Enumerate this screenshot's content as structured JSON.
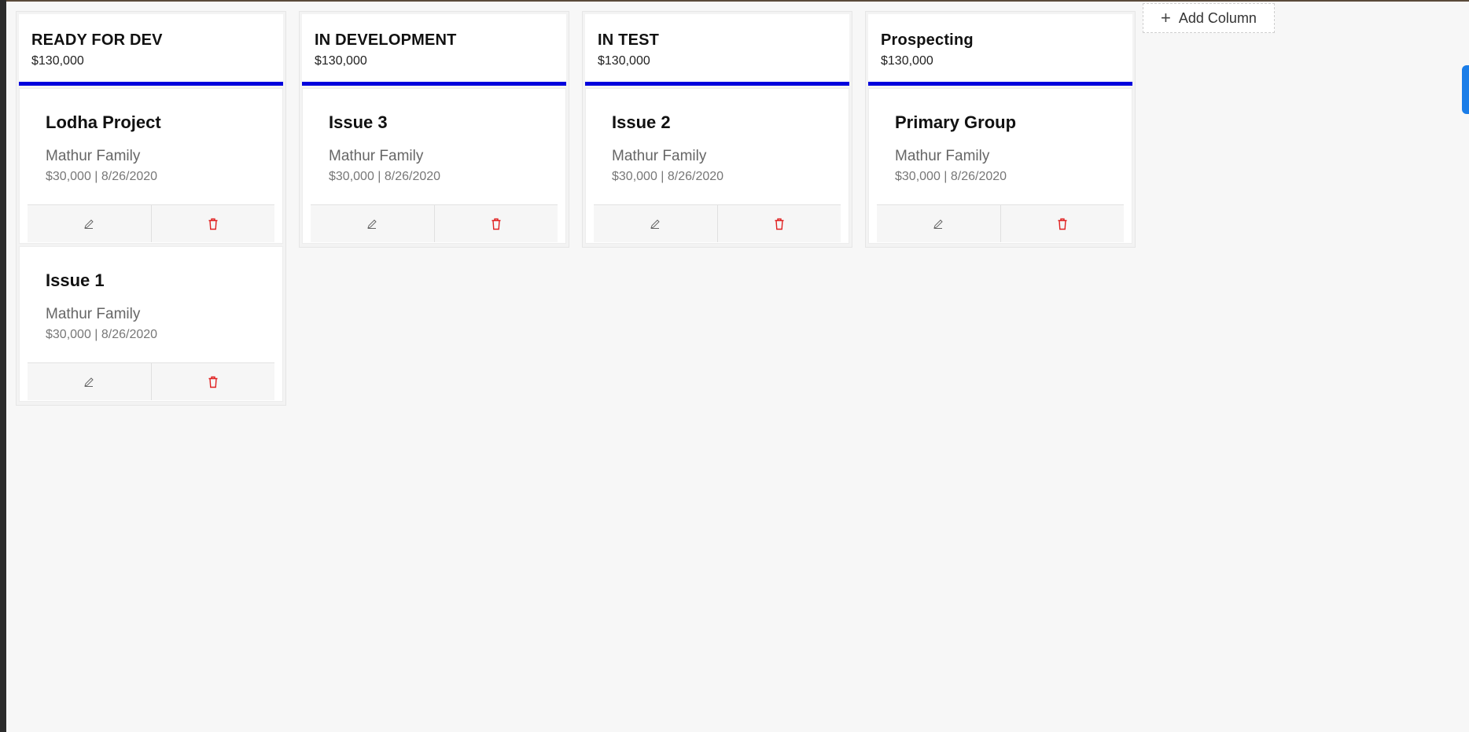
{
  "columns": [
    {
      "title": "READY FOR DEV",
      "total": "$130,000",
      "cards": [
        {
          "title": "Lodha Project",
          "client": "Mathur Family",
          "meta": "$30,000 | 8/26/2020"
        },
        {
          "title": "Issue 1",
          "client": "Mathur Family",
          "meta": "$30,000 | 8/26/2020"
        }
      ]
    },
    {
      "title": "IN DEVELOPMENT",
      "total": "$130,000",
      "cards": [
        {
          "title": "Issue 3",
          "client": "Mathur Family",
          "meta": "$30,000 | 8/26/2020"
        }
      ]
    },
    {
      "title": "IN TEST",
      "total": "$130,000",
      "cards": [
        {
          "title": "Issue 2",
          "client": "Mathur Family",
          "meta": "$30,000 | 8/26/2020"
        }
      ]
    },
    {
      "title": "Prospecting",
      "total": "$130,000",
      "cards": [
        {
          "title": "Primary Group",
          "client": "Mathur Family",
          "meta": "$30,000 | 8/26/2020"
        }
      ]
    }
  ],
  "add_column": {
    "label": "Add Column",
    "icon": "plus-icon"
  },
  "icons": {
    "edit": "pencil-icon",
    "delete": "trash-icon"
  },
  "colors": {
    "accent": "#0000dd",
    "delete": "#e02020",
    "side_tab": "#1a7de8"
  }
}
